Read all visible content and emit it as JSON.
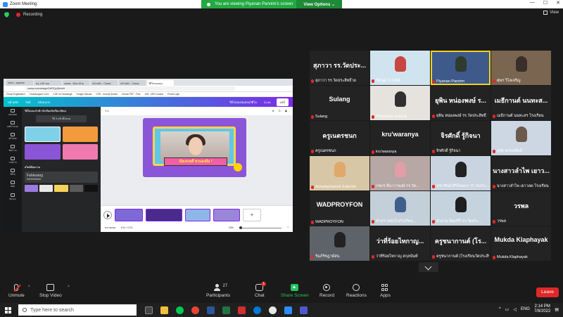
{
  "window": {
    "title": "Zoom Meeting"
  },
  "banner": {
    "text": "You are viewing Piyanan Pannim's screen",
    "view_options": "View Options ⌄"
  },
  "recording": {
    "label": "Recording"
  },
  "view": {
    "label": "View"
  },
  "share": {
    "tabs": [
      "Inbox - piyanan",
      "ครู 1.65 รอบ",
      "canva - ค้นหาด้วย",
      "หน้าหลัก - Canva",
      "หน้าหลัก - Canva",
      "วิดีโอของคุณ"
    ],
    "url": "canva.com/design/DAFfQpQk/edit",
    "bookmarks": [
      "Chula Knightwatch",
      "Chulalongkorn Univ",
      "CUE at Chulalongk",
      "Google Scholar",
      "GJR - Journal Search",
      "Unlock PDF - Free",
      "JHE - MIS Coaboo",
      "Portal Login"
    ],
    "canva_header": {
      "home": "หน้าหลัก",
      "file": "ไฟล์",
      "resize": "ปรับขนาด",
      "title": "วิดีโอของฉันสอนวิดีโอ",
      "time": "21.8s",
      "share": "แชร์"
    },
    "rail": [
      "เทมเพลต",
      "องค์ประกอบ",
      "อัปโหลด",
      "ข้อความ",
      "ภาพถ่าย",
      "วิดีโอ",
      "เพลง",
      "Bitmoji"
    ],
    "panel": {
      "title": "วิดีโอแนะนำตัว นักเรียนนักเรียน ศิลปะ",
      "use_button": "ใช้ 4 หน้าทั้งหมด",
      "section": "สไตล์ข้อความ",
      "font": "Fahkwang",
      "font_sub": "FAHKWANG"
    },
    "design_caption": "มีสเทรดดี้ ชวนลงมือ !",
    "stage_toolbar": "ร่าง",
    "timeline": {
      "status": "0:11 / 0:21",
      "zoom": "24%",
      "notes": "หมายเหตุ"
    }
  },
  "gallery": [
    {
      "big": "สุภาวา รร.วัดประ...",
      "cap": "สุภาวา รร.วัดประสิทธิ์วย",
      "bg": "#232323"
    },
    {
      "big": "",
      "cap": "กิติวุฒิ ไกรเลิศ",
      "bg": "#cfe4ef",
      "person": "#c7463f"
    },
    {
      "big": "",
      "cap": "Piyanan Pannim",
      "bg": "#3d5a8a",
      "person": "#2f3b2f",
      "hl": true
    },
    {
      "big": "",
      "cap": "ศุพร วิไลเจริญ",
      "bg": "#7a6550",
      "person": "#3a2f28"
    },
    {
      "big": "Sulang",
      "cap": "Sulang",
      "bg": "#232323"
    },
    {
      "big": "",
      "cap": "Phonphan pobsuk",
      "bg": "#e6e3df",
      "person": "#303030"
    },
    {
      "big": "ยุพิน หน่องพงษ์ ร...",
      "cap": "ยุพิน หน่องพงษ์ รร.วัดประสิทธิ์",
      "bg": "#232323"
    },
    {
      "big": "เมธีกานต์ นนทะส...",
      "cap": "เมธีกานต์ นนทะสร โรงเรียน",
      "bg": "#232323"
    },
    {
      "big": "ครูเนตรชนก",
      "cap": "ครูเนตรชนก",
      "bg": "#232323"
    },
    {
      "big": "kru'waranya",
      "cap": "kru'waranya",
      "bg": "#232323"
    },
    {
      "big": "จิรศักดิ์ รู้กิจนา",
      "cap": "จิรศักดิ์ รู้กิจนา",
      "bg": "#232323"
    },
    {
      "big": "",
      "cap": "อุทัย พรหมศิษย์",
      "bg": "#cdd6e3",
      "person": "#6b5a4a"
    },
    {
      "big": "",
      "cap": "Achadachanok Sukchid",
      "bg": "#d8c7a6",
      "person": "#e0a86a"
    },
    {
      "big": "",
      "cap": "กชภร ลีนาวาพงษ์ รร.วัด...",
      "bg": "#b7a7a5",
      "person": "#e19ea6"
    },
    {
      "big": "",
      "cap": "จุฑาทิพย์ ศิริโพนพร รร.วัดประ...",
      "bg": "#c9d4e0",
      "person": "#222"
    },
    {
      "big": "นางสาวลำไพ เยาว...",
      "cap": "นางสาวลำไพ เยาวลด โรงเรียน",
      "bg": "#232323"
    },
    {
      "big": "WADPROYFON",
      "cap": "WADPROYFON",
      "bg": "#232323"
    },
    {
      "big": "",
      "cap": "ชำปรางณ์ปุ่ไปกับเรียน...",
      "bg": "#c3cfd9",
      "person": "#3f5e8c"
    },
    {
      "big": "",
      "cap": "ลำดวน นิยมรีริ รร.วัดประ...",
      "bg": "#c5d3de",
      "person": "#1f1f1f"
    },
    {
      "big": "วรพล",
      "cap": "วรพล",
      "bg": "#232323"
    },
    {
      "big": "",
      "cap": "รัมภ์รัชฎามัสน",
      "bg": "#5e6369",
      "person": "#222"
    },
    {
      "big": "ว่าที่ร้อยไทกาญ...",
      "cap": "ว่าที่ร้อยไทกาญ สกุลนันท์",
      "bg": "#232323"
    },
    {
      "big": "ครูชนากานต์ (โร...",
      "cap": "ครูชนากานต์ (โรงเรียนวัดประสิทธิ์)",
      "bg": "#232323"
    },
    {
      "big": "Mukda Klaphayak",
      "cap": "Mukda Klaphayak",
      "bg": "#232323"
    }
  ],
  "controls": {
    "unmute": "Unmute",
    "stop_video": "Stop Video",
    "participants": "Participants",
    "participants_count": "27",
    "chat": "Chat",
    "chat_badge": "1",
    "share_screen": "Share Screen",
    "record": "Record",
    "reactions": "Reactions",
    "apps": "Apps",
    "leave": "Leave"
  },
  "taskbar": {
    "search_placeholder": "Type here to search",
    "lang": "ENG",
    "time": "2:14 PM",
    "date": "7/8/2022"
  }
}
